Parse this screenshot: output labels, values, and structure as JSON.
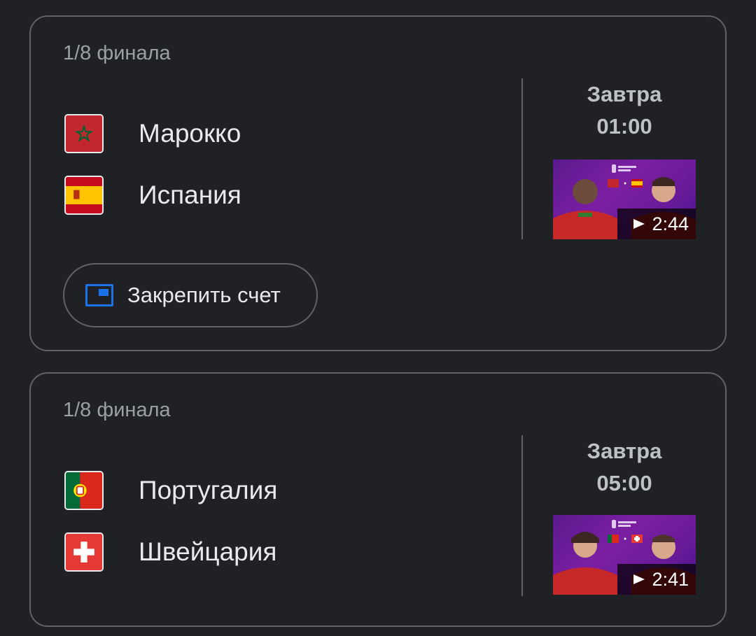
{
  "matches": [
    {
      "stage": "1/8 финала",
      "home": {
        "name": "Марокко",
        "flag_icon": "morocco-flag-icon"
      },
      "away": {
        "name": "Испания",
        "flag_icon": "spain-flag-icon"
      },
      "day": "Завтра",
      "time": "01:00",
      "video_duration": "2:44",
      "pin_label": "Закрепить счет"
    },
    {
      "stage": "1/8 финала",
      "home": {
        "name": "Португалия",
        "flag_icon": "portugal-flag-icon"
      },
      "away": {
        "name": "Швейцария",
        "flag_icon": "switzerland-flag-icon"
      },
      "day": "Завтра",
      "time": "05:00",
      "video_duration": "2:41"
    }
  ],
  "colors": {
    "background": "#202124",
    "border": "#5f6368",
    "text_primary": "#e8eaed",
    "text_secondary": "#9aa0a6",
    "accent": "#1a73e8",
    "thumbnail_purple": "#7b1fa2"
  }
}
